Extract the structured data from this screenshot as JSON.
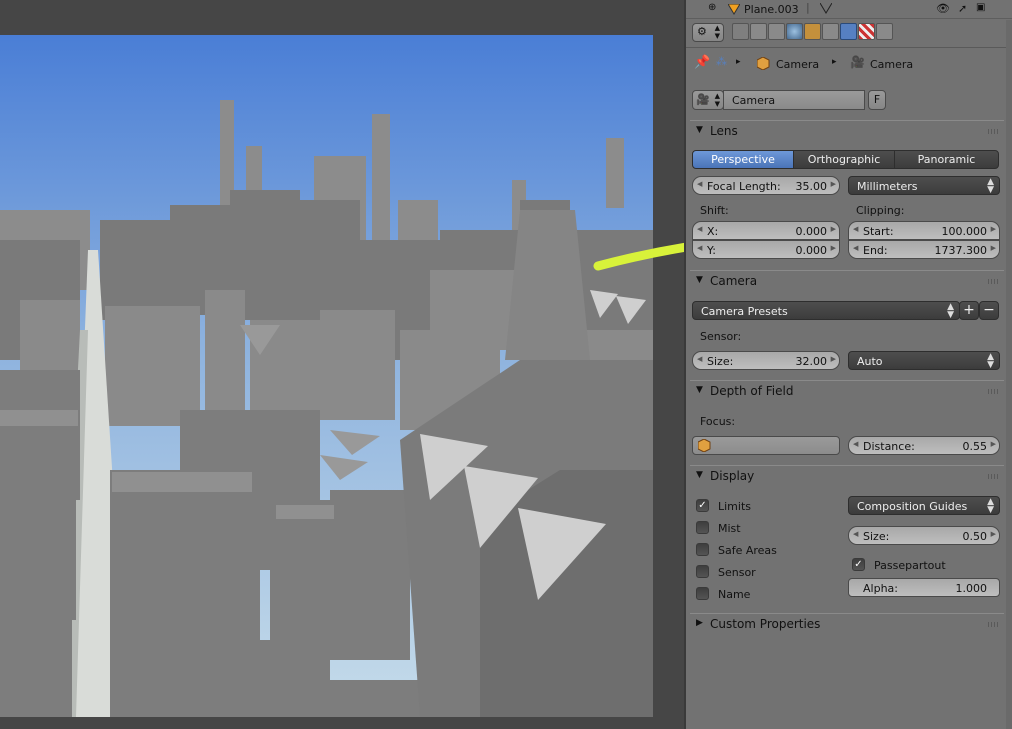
{
  "outliner": {
    "object_name": "Plane.003"
  },
  "breadcrumb": {
    "object": "Camera",
    "data": "Camera"
  },
  "datablock": {
    "name": "Camera",
    "fake_user": "F"
  },
  "lens": {
    "title": "Lens",
    "tabs": [
      "Perspective",
      "Orthographic",
      "Panoramic"
    ],
    "active_tab": "Perspective",
    "focal_length_label": "Focal Length:",
    "focal_length_value": "35.00",
    "unit": "Millimeters",
    "shift_label": "Shift:",
    "shift_x_label": "X:",
    "shift_x_value": "0.000",
    "shift_y_label": "Y:",
    "shift_y_value": "0.000",
    "clipping_label": "Clipping:",
    "clip_start_label": "Start:",
    "clip_start_value": "100.000",
    "clip_end_label": "End:",
    "clip_end_value": "1737.300"
  },
  "camera": {
    "title": "Camera",
    "presets": "Camera Presets",
    "sensor_label": "Sensor:",
    "size_label": "Size:",
    "size_value": "32.00",
    "fit": "Auto"
  },
  "dof": {
    "title": "Depth of Field",
    "focus_label": "Focus:",
    "distance_label": "Distance:",
    "distance_value": "0.55"
  },
  "display": {
    "title": "Display",
    "checks": [
      {
        "label": "Limits",
        "checked": true
      },
      {
        "label": "Mist",
        "checked": false
      },
      {
        "label": "Safe Areas",
        "checked": false
      },
      {
        "label": "Sensor",
        "checked": false
      },
      {
        "label": "Name",
        "checked": false
      }
    ],
    "composition": "Composition Guides",
    "size_label": "Size:",
    "size_value": "0.50",
    "passepartout_label": "Passepartout",
    "passepartout_checked": true,
    "alpha_label": "Alpha:",
    "alpha_value": "1.000"
  },
  "custom_properties": {
    "title": "Custom Properties"
  },
  "colors": {
    "accent": "#5680c2",
    "annotation_arrow": "#d8f23a",
    "sky_top": "#4a7ed6",
    "sky_bottom": "#c6dcea"
  }
}
